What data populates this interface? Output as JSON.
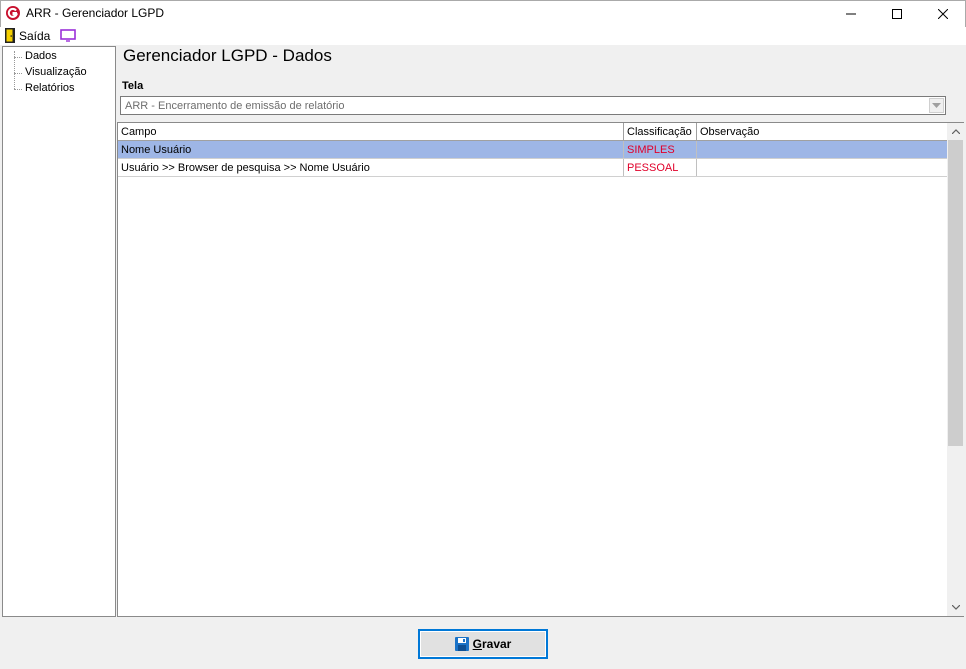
{
  "window": {
    "title": "ARR - Gerenciador LGPD"
  },
  "toolbar": {
    "exit_label": "Saída"
  },
  "tree": {
    "items": [
      {
        "label": "Dados"
      },
      {
        "label": "Visualização"
      },
      {
        "label": "Relatórios"
      }
    ]
  },
  "main": {
    "title": "Gerenciador LGPD - Dados",
    "tela_label": "Tela",
    "tela_value": "ARR - Encerramento de emissão de relatório"
  },
  "grid": {
    "columns": [
      "Campo",
      "Classificação",
      "Observação"
    ],
    "rows": [
      {
        "campo": "Nome Usuário",
        "classificacao": "SIMPLES",
        "observacao": ""
      },
      {
        "campo": "Usuário >> Browser de pesquisa >> Nome Usuário",
        "classificacao": "PESSOAL",
        "observacao": ""
      }
    ]
  },
  "buttons": {
    "save_first": "G",
    "save_rest": "ravar"
  },
  "colors": {
    "selected_row": "#9eb6e6",
    "classification_text": "#e0002a",
    "accent": "#0078d7"
  },
  "icons": [
    "app-logo",
    "door-icon",
    "monitor-icon",
    "save-disk-icon"
  ]
}
